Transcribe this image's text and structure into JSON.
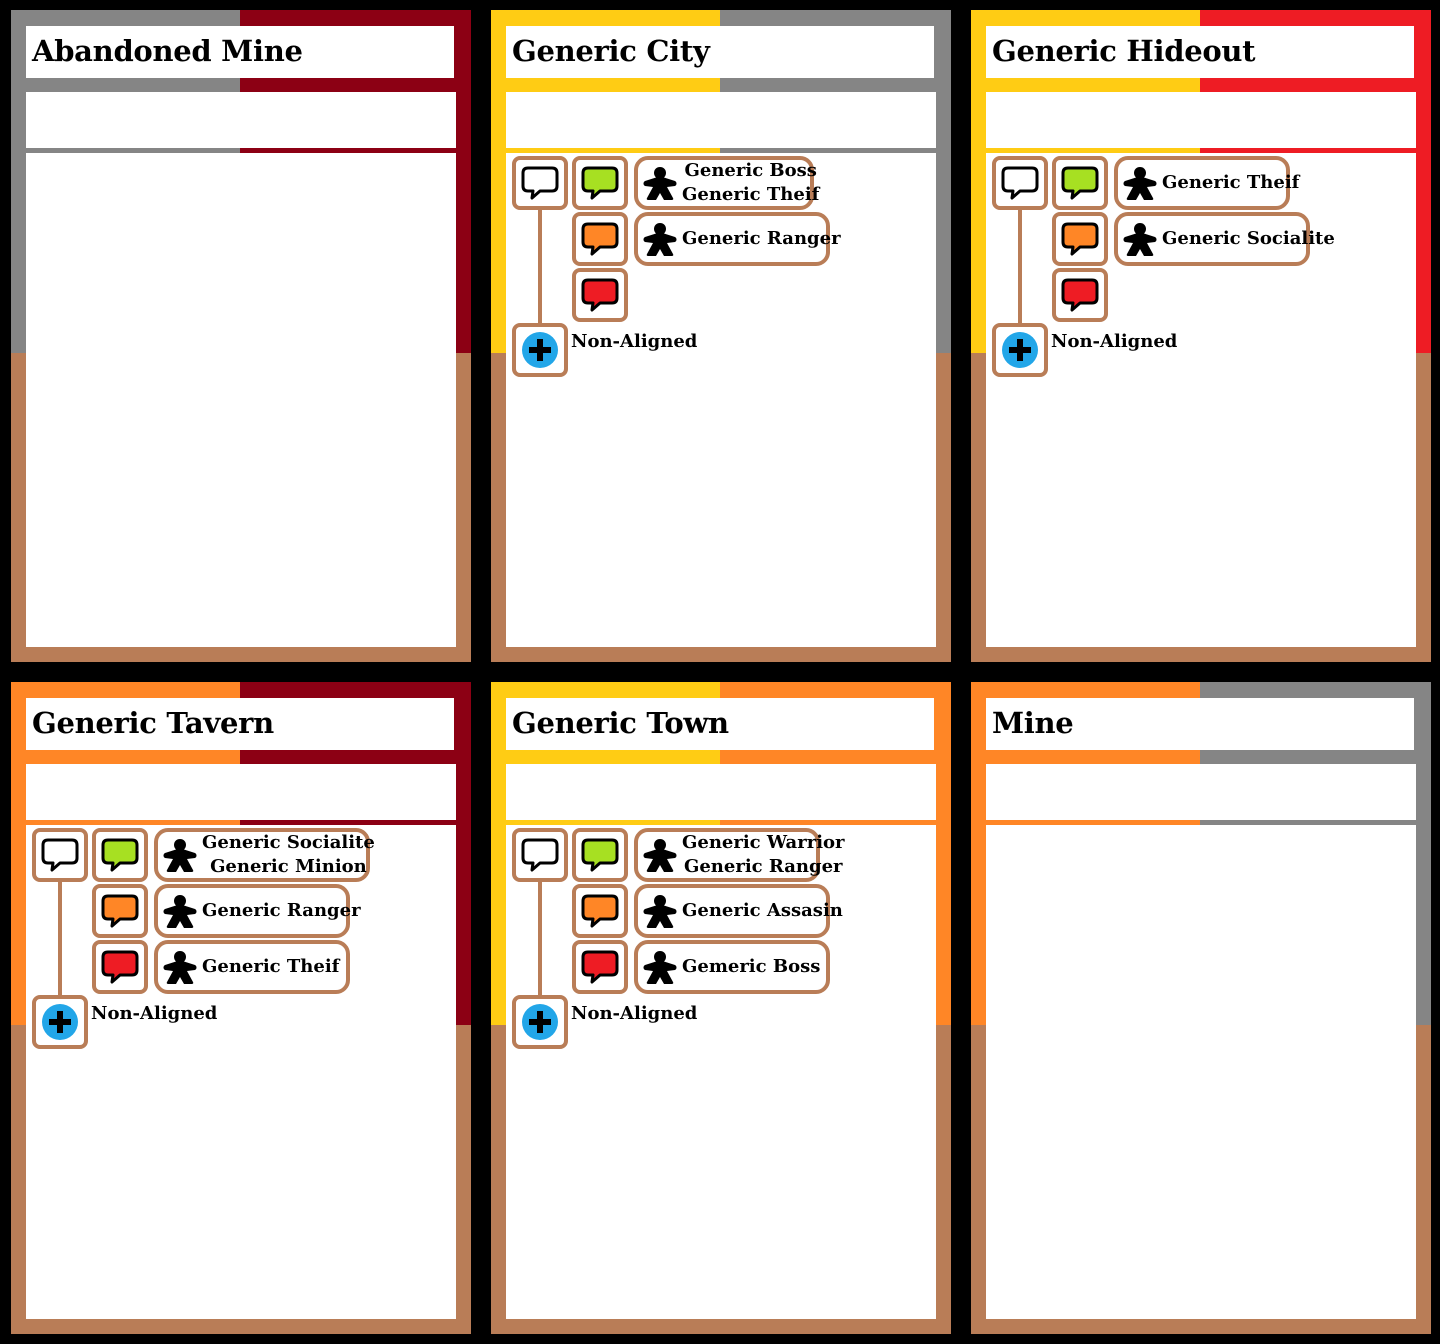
{
  "colors": {
    "black": "#000000",
    "gray": "#858585",
    "dark_red": "#8c0014",
    "yellow": "#ffcc14",
    "red": "#ee1c24",
    "orange": "#ff8626",
    "brown": "#b97d57",
    "bubble_white": "#ffffff",
    "bubble_green": "#a7e022",
    "bubble_orange": "#ff8626",
    "bubble_red": "#ee1c24",
    "plus_blue": "#22a6e8"
  },
  "icons": {
    "bubble": "speech-bubble-icon",
    "meeple": "meeple-icon",
    "plus": "plus-icon"
  },
  "cards": [
    {
      "title": "Abandoned Mine",
      "band_left": "gray",
      "band_right": "dark_red",
      "rows": [],
      "faction_label": ""
    },
    {
      "title": "Generic City",
      "band_left": "yellow",
      "band_right": "gray",
      "rows": [
        {
          "bubble": "bubble_green",
          "names": [
            "Generic Boss",
            "Generic Theif"
          ]
        },
        {
          "bubble": "bubble_orange",
          "names": [
            "Generic Ranger"
          ]
        },
        {
          "bubble": "bubble_red",
          "names": []
        }
      ],
      "faction_label": "Non-Aligned"
    },
    {
      "title": "Generic Hideout",
      "band_left": "yellow",
      "band_right": "red",
      "rows": [
        {
          "bubble": "bubble_green",
          "names": [
            "Generic Theif"
          ]
        },
        {
          "bubble": "bubble_orange",
          "names": [
            "Generic Socialite"
          ]
        },
        {
          "bubble": "bubble_red",
          "names": []
        }
      ],
      "faction_label": "Non-Aligned"
    },
    {
      "title": "Generic Tavern",
      "band_left": "orange",
      "band_right": "dark_red",
      "rows": [
        {
          "bubble": "bubble_green",
          "names": [
            "Generic Socialite",
            "Generic Minion"
          ]
        },
        {
          "bubble": "bubble_orange",
          "names": [
            "Generic Ranger"
          ]
        },
        {
          "bubble": "bubble_red",
          "names": [
            "Generic Theif"
          ]
        }
      ],
      "faction_label": "Non-Aligned"
    },
    {
      "title": "Generic Town",
      "band_left": "yellow",
      "band_right": "orange",
      "rows": [
        {
          "bubble": "bubble_green",
          "names": [
            "Generic Warrior",
            "Generic Ranger"
          ]
        },
        {
          "bubble": "bubble_orange",
          "names": [
            "Generic Assasin"
          ]
        },
        {
          "bubble": "bubble_red",
          "names": [
            "Gemeric Boss"
          ]
        }
      ],
      "faction_label": "Non-Aligned"
    },
    {
      "title": "Mine",
      "band_left": "orange",
      "band_right": "gray",
      "rows": [],
      "faction_label": ""
    }
  ]
}
